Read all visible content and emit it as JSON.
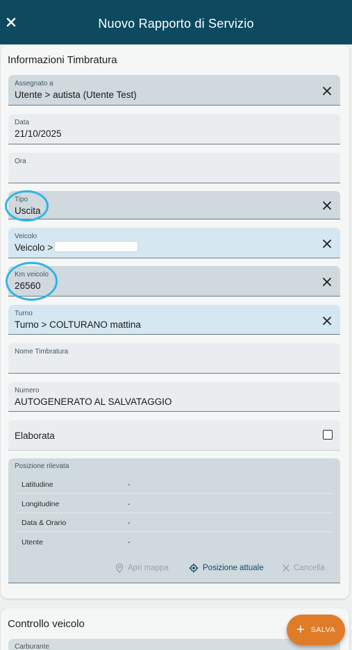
{
  "header": {
    "title": "Nuovo Rapporto di Servizio",
    "close_icon": "close-icon"
  },
  "section1": {
    "title": "Informazioni Timbratura",
    "fields": {
      "assegnato": {
        "label": "Assegnato a",
        "value": "Utente > autista (Utente Test)"
      },
      "data": {
        "label": "Data",
        "value": "21/10/2025"
      },
      "ora": {
        "label": "Ora",
        "value": ""
      },
      "tipo": {
        "label": "Tipo",
        "value": "Uscita"
      },
      "veicolo": {
        "label": "Veicolo",
        "value": "Veicolo >"
      },
      "km": {
        "label": "Km veicolo",
        "value": "26560"
      },
      "turno": {
        "label": "Turno",
        "value": "Turno > COLTURANO mattina"
      },
      "nome": {
        "label": "Nome Timbratura",
        "value": ""
      },
      "numero": {
        "label": "Numero",
        "value": "AUTOGENERATO AL SALVATAGGIO"
      }
    },
    "elaborata": {
      "label": "Elaborata",
      "checked": false
    },
    "posizione": {
      "label": "Posizione rilevata",
      "rows": [
        {
          "key": "Latitudine",
          "value": "-"
        },
        {
          "key": "Longitudine",
          "value": "-"
        },
        {
          "key": "Data & Orario",
          "value": "-"
        },
        {
          "key": "Utente",
          "value": "-"
        }
      ],
      "actions": {
        "apri_mappa": "Apri mappa",
        "posizione_attuale": "Posizione attuale",
        "cancella": "Cancella"
      }
    }
  },
  "section2": {
    "title": "Controllo veicolo",
    "carburante_label": "Carburante"
  },
  "fab": {
    "label": "SALVA",
    "icon": "plus-icon"
  },
  "colors": {
    "header": "#0d4a60",
    "accent": "#e07b28",
    "annotation_circle": "#2fb5e3"
  }
}
